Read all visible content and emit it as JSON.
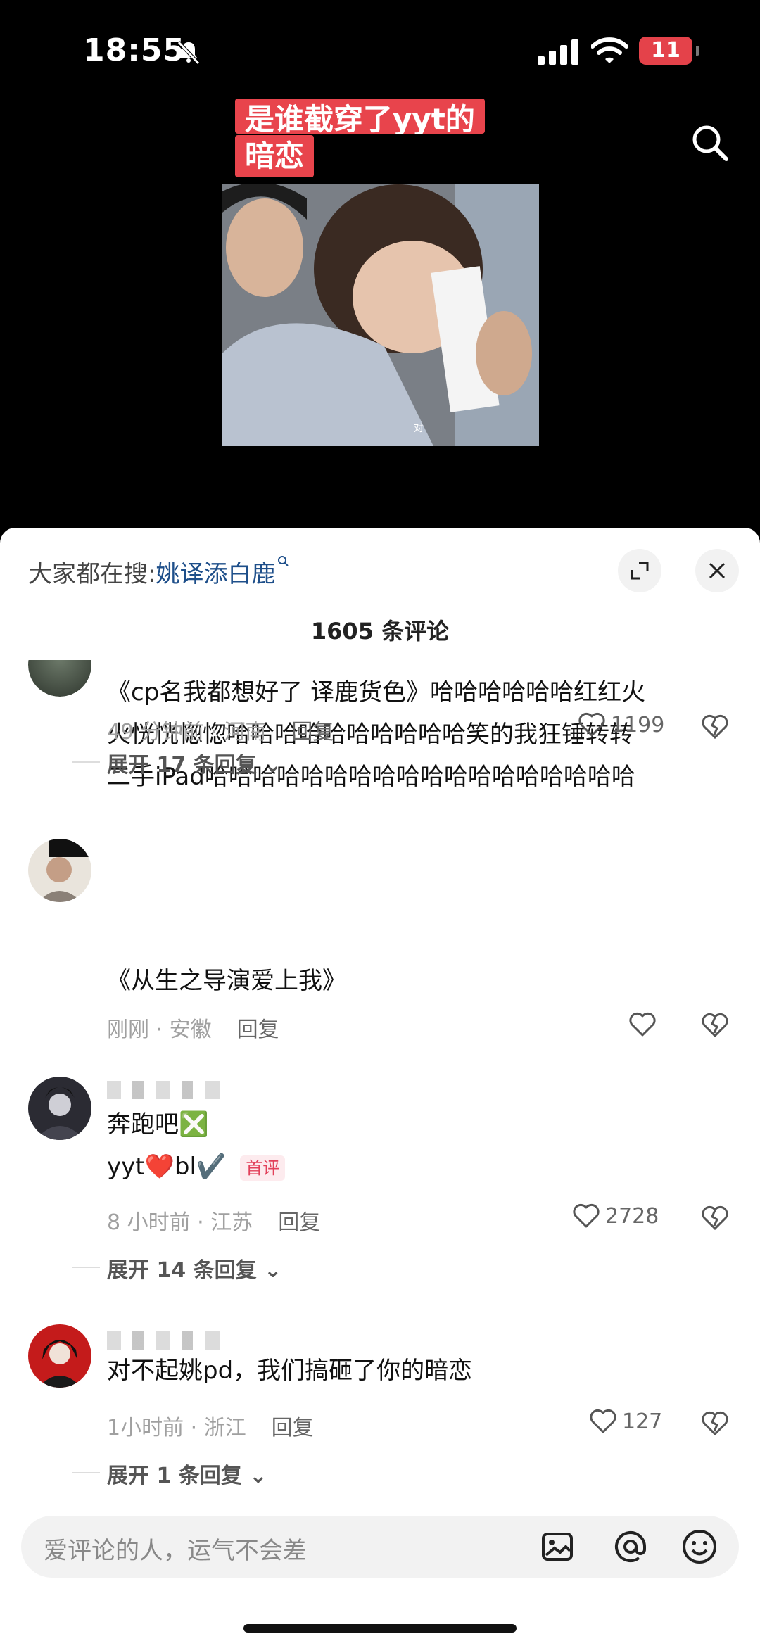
{
  "status_bar": {
    "time": "18:55",
    "battery": "11"
  },
  "video": {
    "caption_line1": "是谁截穿了yyt的",
    "caption_line2": "暗恋",
    "subtitle_char": "对"
  },
  "sheet": {
    "suggest_prefix": "大家都在搜:",
    "suggest_keyword": "姚译添白鹿",
    "comment_count": "1605 条评论"
  },
  "comments": [
    {
      "text_lines": [
        "《cp名我都想好了 译鹿货色》哈哈哈哈哈哈红红火",
        "火恍恍惚惚哈哈哈哈哈哈哈哈哈哈笑的我狂锤转转",
        "二手iPad哈哈哈哈哈哈哈哈哈哈哈哈哈哈哈哈哈哈"
      ],
      "time_loc": "49 分钟前 · 河南",
      "reply": "回复",
      "likes": "1199",
      "expand": "展开 17 条回复"
    },
    {
      "text_lines": [
        "《从生之导演爱上我》"
      ],
      "time_loc": "刚刚 · 安徽",
      "reply": "回复",
      "likes": "",
      "expand": ""
    },
    {
      "text_lines": [
        "奔跑吧❎",
        "yyt❤️bl✔️"
      ],
      "tag": "首评",
      "time_loc": "8 小时前 · 江苏",
      "reply": "回复",
      "likes": "2728",
      "expand": "展开 14 条回复"
    },
    {
      "text_lines": [
        "对不起姚pd，我们搞砸了你的暗恋"
      ],
      "time_loc": "1小时前 · 浙江",
      "reply": "回复",
      "likes": "127",
      "expand": "展开 1 条回复"
    }
  ],
  "input": {
    "placeholder": "爱评论的人，运气不会差"
  },
  "colors": {
    "caption_bg": "#e8444c",
    "link": "#1e4f8a",
    "tag": "#e2415a"
  }
}
